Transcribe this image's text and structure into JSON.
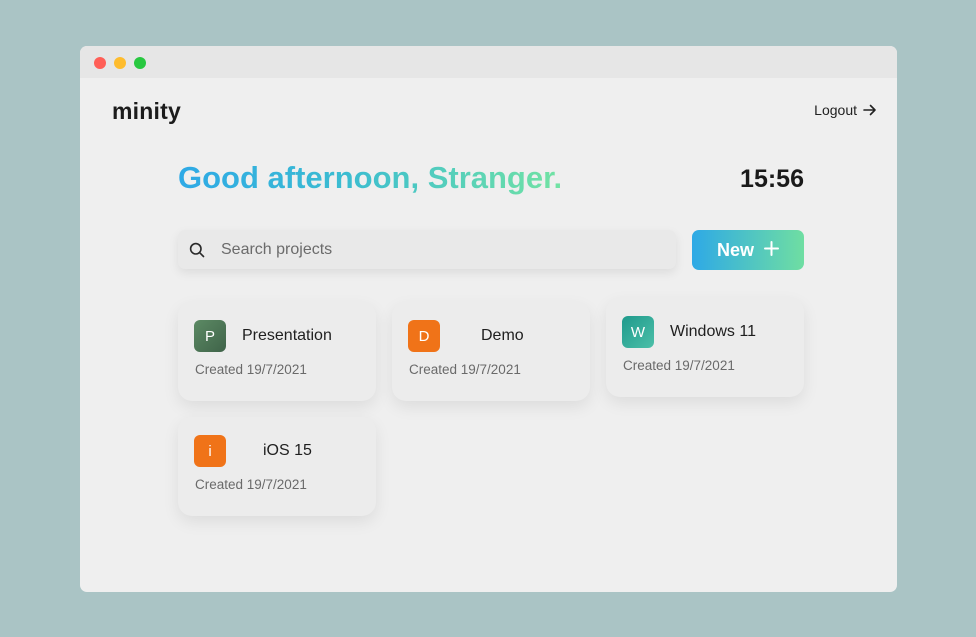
{
  "window": {
    "controls": [
      "close",
      "minimize",
      "maximize"
    ]
  },
  "header": {
    "logo": "minity",
    "logout_label": "Logout",
    "logout_icon": "arrow-right-icon"
  },
  "greeting": "Good afternoon, Stranger.",
  "clock": "15:56",
  "search": {
    "placeholder": "Search projects",
    "value": "",
    "icon": "search-icon"
  },
  "new_button": {
    "label": "New",
    "icon": "plus-icon"
  },
  "colors": {
    "accent_start": "#2ea9e6",
    "accent_end": "#72e3a3",
    "badge_green": "#4e7a5a",
    "badge_orange": "#f07318",
    "badge_teal": "#2fa48c"
  },
  "projects": [
    {
      "initial": "P",
      "name": "Presentation",
      "created": "Created 19/7/2021"
    },
    {
      "initial": "D",
      "name": "Demo",
      "created": "Created 19/7/2021"
    },
    {
      "initial": "W",
      "name": "Windows 11",
      "created": "Created 19/7/2021"
    },
    {
      "initial": "i",
      "name": "iOS 15",
      "created": "Created 19/7/2021"
    }
  ]
}
